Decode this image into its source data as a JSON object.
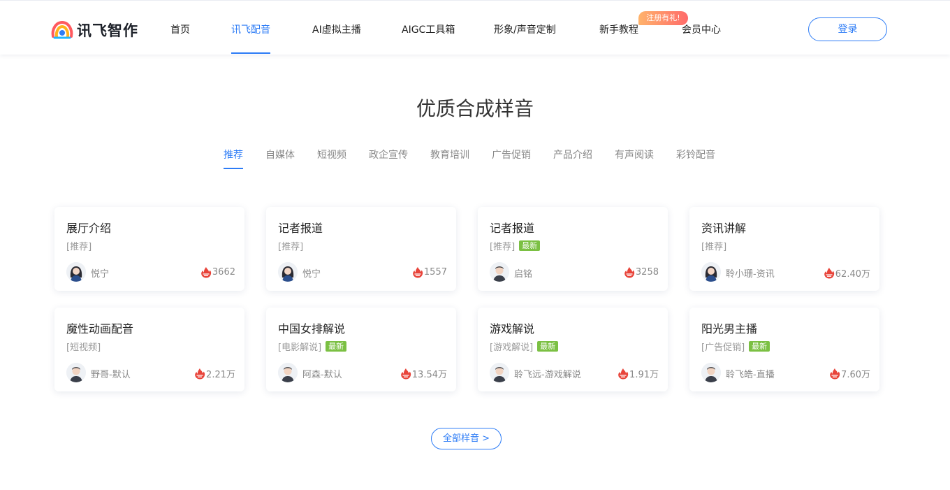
{
  "header": {
    "logo_text": "讯飞智作",
    "nav": [
      {
        "label": "首页"
      },
      {
        "label": "讯飞配音"
      },
      {
        "label": "AI虚拟主播"
      },
      {
        "label": "AIGC工具箱"
      },
      {
        "label": "形象/声音定制"
      },
      {
        "label": "新手教程"
      },
      {
        "label": "会员中心"
      }
    ],
    "active_nav": "讯飞配音",
    "promo_badge": "注册有礼!",
    "login_label": "登录"
  },
  "section": {
    "title": "优质合成样音",
    "categories": [
      "推荐",
      "自媒体",
      "短视频",
      "政企宣传",
      "教育培训",
      "广告促销",
      "产品介绍",
      "有声阅读",
      "彩铃配音"
    ],
    "active_category": "推荐"
  },
  "cards": [
    {
      "title": "展厅介绍",
      "tag": "[推荐]",
      "new": "",
      "speaker": "悦宁",
      "plays": "3662",
      "avatar": "female-avatar"
    },
    {
      "title": "记者报道",
      "tag": "[推荐]",
      "new": "",
      "speaker": "悦宁",
      "plays": "1557",
      "avatar": "female-avatar"
    },
    {
      "title": "记者报道",
      "tag": "[推荐]",
      "new": "最新",
      "speaker": "启铭",
      "plays": "3258",
      "avatar": "male-avatar"
    },
    {
      "title": "资讯讲解",
      "tag": "[推荐]",
      "new": "",
      "speaker": "聆小珊-资讯",
      "plays": "62.40万",
      "avatar": "female-avatar"
    },
    {
      "title": "魔性动画配音",
      "tag": "[短视频]",
      "new": "",
      "speaker": "野哥-默认",
      "plays": "2.21万",
      "avatar": "male-avatar"
    },
    {
      "title": "中国女排解说",
      "tag": "[电影解说]",
      "new": "最新",
      "speaker": "阿森-默认",
      "plays": "13.54万",
      "avatar": "male-avatar"
    },
    {
      "title": "游戏解说",
      "tag": "[游戏解说]",
      "new": "最新",
      "speaker": "聆飞远-游戏解说",
      "plays": "1.91万",
      "avatar": "male-avatar"
    },
    {
      "title": "阳光男主播",
      "tag": "[广告促销]",
      "new": "最新",
      "speaker": "聆飞皓-直播",
      "plays": "7.60万",
      "avatar": "male-avatar"
    }
  ],
  "more_button": "全部样音 >",
  "colors": {
    "accent": "#2d7cf6",
    "new_badge": "#7bc043",
    "fire": "#e8443a"
  }
}
